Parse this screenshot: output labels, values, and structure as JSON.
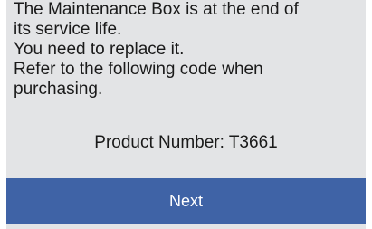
{
  "dialog": {
    "message": "The Maintenance Box is at the end of\nits service life.\nYou need to replace it.\nRefer to the following code when\npurchasing.",
    "product_number": "Product Number: T3661",
    "next_label": "Next"
  },
  "colors": {
    "panel_background": "#e3e4e6",
    "button_background": "#3f63a6",
    "text": "#1a1a1a",
    "button_text": "#ffffff"
  }
}
